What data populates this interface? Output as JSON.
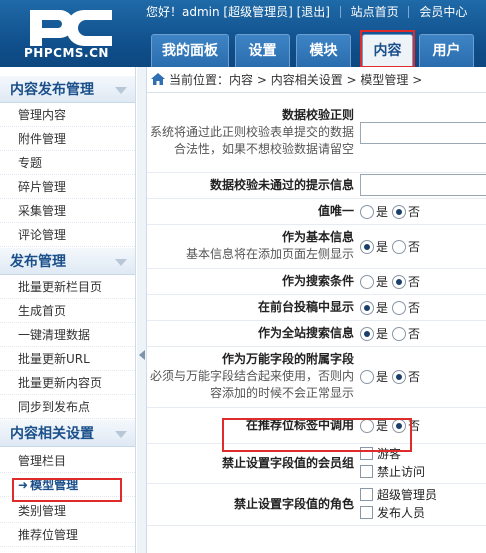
{
  "brand": {
    "logo_text": "PHPCMS.CN"
  },
  "topbar": {
    "greeting": "您好！admin [超级管理员]",
    "logout": "[退出]",
    "site_home": "站点首页",
    "member_center": "会员中心"
  },
  "tabs": [
    "我的面板",
    "设置",
    "模块",
    "内容",
    "用户"
  ],
  "active_tab": "内容",
  "sidebar": {
    "sections": [
      {
        "title": "内容发布管理",
        "items": [
          "管理内容",
          "附件管理",
          "专题",
          "碎片管理",
          "采集管理",
          "评论管理"
        ]
      },
      {
        "title": "发布管理",
        "items": [
          "批量更新栏目页",
          "生成首页",
          "一键清理数据",
          "批量更新URL",
          "批量更新内容页",
          "同步到发布点"
        ]
      },
      {
        "title": "内容相关设置",
        "items": [
          "管理栏目",
          "模型管理",
          "类别管理",
          "推荐位管理"
        ]
      }
    ],
    "active_item": "模型管理"
  },
  "breadcrumb": {
    "label": "当前位置：",
    "path": "内容 > 内容相关设置 > 模型管理 >"
  },
  "form": {
    "regex": {
      "label": "数据校验正则",
      "desc": "系统将通过此正则校验表单提交的数据合法性，如果不想校验数据请留空"
    },
    "error_msg": {
      "label": "数据校验未通过的提示信息"
    },
    "unique": {
      "label": "值唯一"
    },
    "basic": {
      "label": "作为基本信息",
      "desc": "基本信息将在添加页面左侧显示"
    },
    "search": {
      "label": "作为搜索条件"
    },
    "backend_show": {
      "label": "在前台投稿中显示"
    },
    "site_search": {
      "label": "作为全站搜索信息"
    },
    "omni": {
      "label": "作为万能字段的附属字段",
      "desc": "必须与万能字段结合起来使用，否则内容添加的时候不会正常显示"
    },
    "position": {
      "label": "在推荐位标签中调用"
    },
    "forbid_member": {
      "label": "禁止设置字段值的会员组",
      "options": [
        "游客",
        "禁止访问"
      ]
    },
    "forbid_role": {
      "label": "禁止设置字段值的角色",
      "options": [
        "超级管理员",
        "发布人员"
      ]
    },
    "yes": "是",
    "no": "否"
  }
}
